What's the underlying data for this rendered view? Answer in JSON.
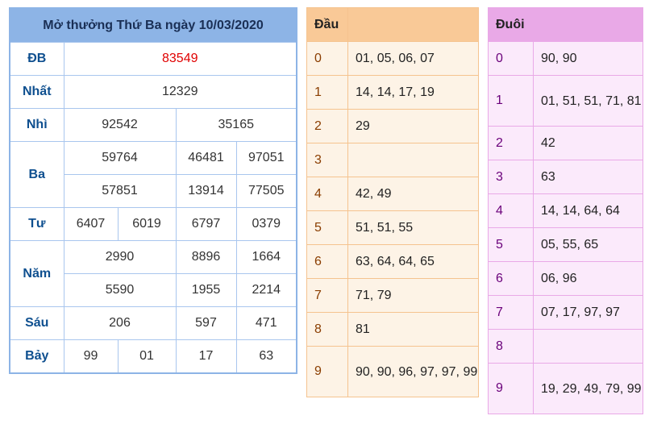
{
  "main": {
    "title": "Mở thưởng Thứ Ba ngày 10/03/2020",
    "rows": {
      "db": {
        "label": "ĐB",
        "values": [
          "83549"
        ]
      },
      "nhat": {
        "label": "Nhất",
        "values": [
          "12329"
        ]
      },
      "nhi": {
        "label": "Nhì",
        "values": [
          "92542",
          "35165"
        ]
      },
      "ba": {
        "label": "Ba",
        "values": [
          "59764",
          "46481",
          "97051",
          "57851",
          "13914",
          "77505"
        ]
      },
      "tu": {
        "label": "Tư",
        "values": [
          "6407",
          "6019",
          "6797",
          "0379"
        ]
      },
      "nam": {
        "label": "Năm",
        "values": [
          "2990",
          "8896",
          "1664",
          "5590",
          "1955",
          "2214"
        ]
      },
      "sau": {
        "label": "Sáu",
        "values": [
          "206",
          "597",
          "471"
        ]
      },
      "bay": {
        "label": "Bảy",
        "values": [
          "99",
          "01",
          "17",
          "63"
        ]
      }
    },
    "highlight_color": "#e00000"
  },
  "dau": {
    "header": "Đầu",
    "rows": [
      {
        "k": "0",
        "v": "01, 05, 06, 07"
      },
      {
        "k": "1",
        "v": "14, 14, 17, 19"
      },
      {
        "k": "2",
        "v": "29"
      },
      {
        "k": "3",
        "v": ""
      },
      {
        "k": "4",
        "v": "42, 49"
      },
      {
        "k": "5",
        "v": "51, 51, 55"
      },
      {
        "k": "6",
        "v": "63, 64, 64, 65"
      },
      {
        "k": "7",
        "v": "71, 79"
      },
      {
        "k": "8",
        "v": "81"
      },
      {
        "k": "9",
        "v": "90, 90, 96, 97, 97, 99"
      }
    ]
  },
  "duoi": {
    "header": "Đuôi",
    "rows": [
      {
        "k": "0",
        "v": "90, 90"
      },
      {
        "k": "1",
        "v": "01, 51, 51, 71, 81"
      },
      {
        "k": "2",
        "v": "42"
      },
      {
        "k": "3",
        "v": "63"
      },
      {
        "k": "4",
        "v": "14, 14, 64, 64"
      },
      {
        "k": "5",
        "v": "05, 55, 65"
      },
      {
        "k": "6",
        "v": "06, 96"
      },
      {
        "k": "7",
        "v": "07, 17, 97, 97"
      },
      {
        "k": "8",
        "v": ""
      },
      {
        "k": "9",
        "v": "19, 29, 49, 79, 99"
      }
    ]
  }
}
